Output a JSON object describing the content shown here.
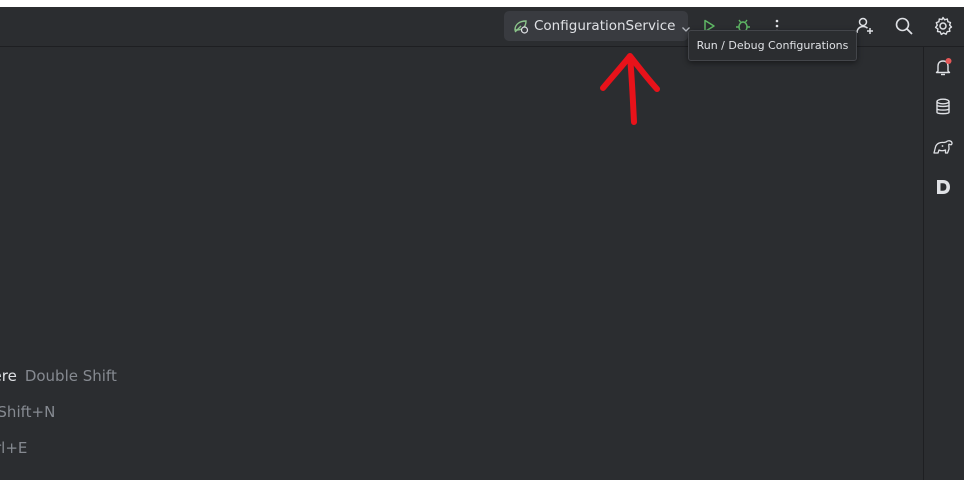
{
  "toolbar": {
    "run_config_label": "ConfigurationService",
    "tooltip": "Run / Debug Configurations"
  },
  "welcome_hints": [
    {
      "action": "here",
      "shortcut": "Double Shift"
    },
    {
      "action": "",
      "shortcut": "-Shift+N"
    },
    {
      "action": "",
      "shortcut": "rl+E"
    }
  ],
  "colors": {
    "background": "#2b2d30",
    "run_green": "#5fb865",
    "debug_green": "#5fb865",
    "notification_dot": "#e55757",
    "annotation_arrow": "#e8121a"
  },
  "icons": {
    "run_config": "spring-boot-leaf-icon",
    "run": "run-play-icon",
    "debug": "debug-bug-icon",
    "more": "more-vertical-icon",
    "add_user": "add-user-icon",
    "search": "search-icon",
    "settings": "gear-icon",
    "notifications": "bell-icon",
    "database": "database-icon",
    "gradle": "gradle-elephant-icon",
    "d_plugin": "d-letter-icon"
  }
}
